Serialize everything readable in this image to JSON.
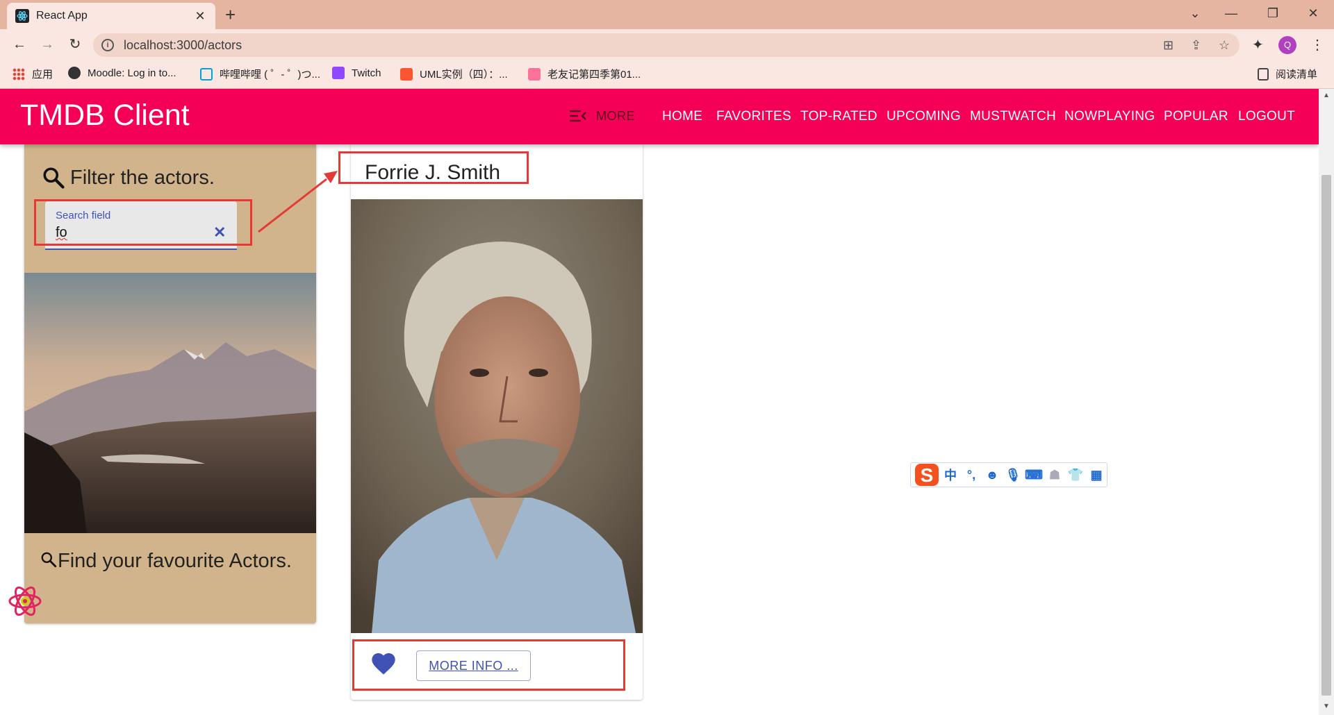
{
  "browser": {
    "tab_title": "React App",
    "url": "localhost:3000/actors",
    "profile_initial": "Q",
    "reading_list": "阅读清单",
    "bookmarks": [
      {
        "label": "应用",
        "icon": "apps-grid-icon"
      },
      {
        "label": "Moodle: Log in to...",
        "icon": "moodle-icon"
      },
      {
        "label": "哔哩哔哩 ( ゜- ゜)つ...",
        "icon": "bilibili-icon"
      },
      {
        "label": "Twitch",
        "icon": "twitch-icon"
      },
      {
        "label": "UML实例（四）：...",
        "icon": "csdn-icon"
      },
      {
        "label": "老友记第四季第01...",
        "icon": "bilibili-pink-icon"
      }
    ]
  },
  "appbar": {
    "brand": "TMDB Client",
    "more_label": "MORE",
    "nav": [
      "HOME",
      "FAVORITES",
      "TOP-RATED",
      "UPCOMING",
      "MUSTWATCH",
      "NOWPLAYING",
      "POPULAR",
      "LOGOUT"
    ]
  },
  "filter": {
    "title": "Filter the actors.",
    "search_label": "Search field",
    "search_value": "fo",
    "find_text": "Find your favourite Actors."
  },
  "actor": {
    "name": "Forrie J. Smith",
    "more_info": "MORE INFO ..."
  },
  "ime": {
    "items": [
      "中",
      "°,"
    ]
  },
  "colors": {
    "appbar": "#f50057",
    "filter_card": "#d2b48c",
    "primary": "#3f51b5",
    "annotation": "#e53935"
  }
}
